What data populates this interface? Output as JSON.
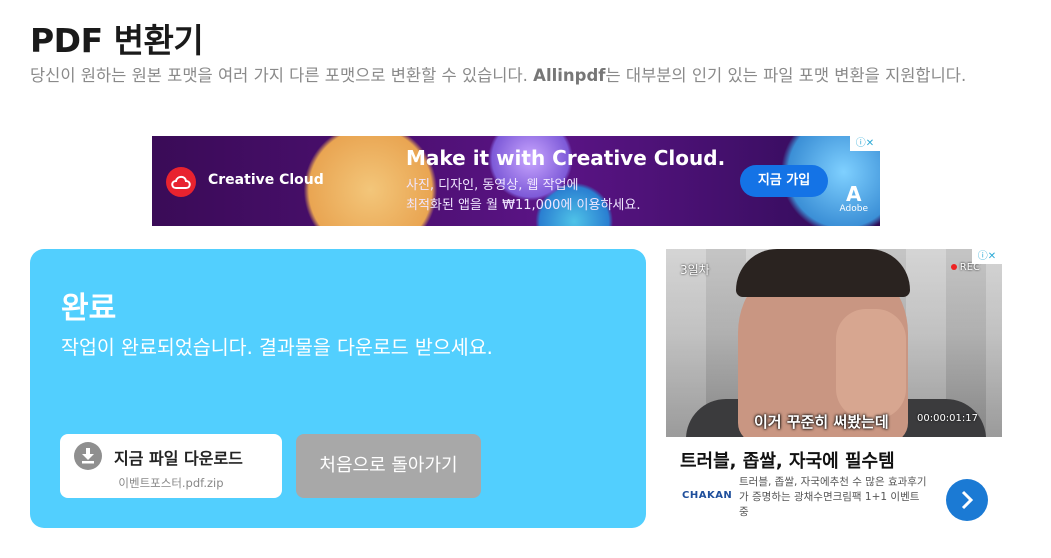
{
  "header": {
    "title": "PDF 변환기",
    "description_before": "당신이 원하는 원본 포맷을 여러 가지 다른 포맷으로 변환할 수 있습니다. ",
    "description_brand": "Allinpdf",
    "description_after": "는 대부분의 인기 있는 파일 포맷 변환을 지원합니다."
  },
  "banner_ad": {
    "brand": "Creative Cloud",
    "headline": "Make it with Creative Cloud.",
    "subline_1": "사진, 디자인, 동영상, 웹 작업에",
    "subline_2": "최적화된 앱을 월 ₩11,000에 이용하세요.",
    "cta": "지금 가입",
    "adobe_label": "Adobe",
    "adobe_letter": "A",
    "adchoice": "ⓘ✕"
  },
  "result": {
    "title": "완료",
    "message": "작업이 완료되었습니다. 결과물을 다운로드 받으세요.",
    "download_label": "지금 파일 다운로드",
    "file_name": "이벤트포스터.pdf.zip",
    "back_label": "처음으로 돌아가기"
  },
  "side_ad": {
    "video_day": "3일차",
    "video_rec": "REC",
    "video_caption": "이거 꾸준히 써봤는데",
    "video_time": "00:00:01:17",
    "headline": "트러블, 좁쌀, 자국에 필수템",
    "brand": "CHAKAN",
    "body": "트러블, 좁쌀, 자국에추천 수 많은 효과후기가 증명하는 광채수면크림팩 1+1 이벤트중",
    "adchoice": "ⓘ✕"
  },
  "colors": {
    "card_bg": "#52cffe",
    "back_button_bg": "#a8a8a8",
    "cta_blue": "#1473e6",
    "arrow_blue": "#1b7ad4"
  }
}
